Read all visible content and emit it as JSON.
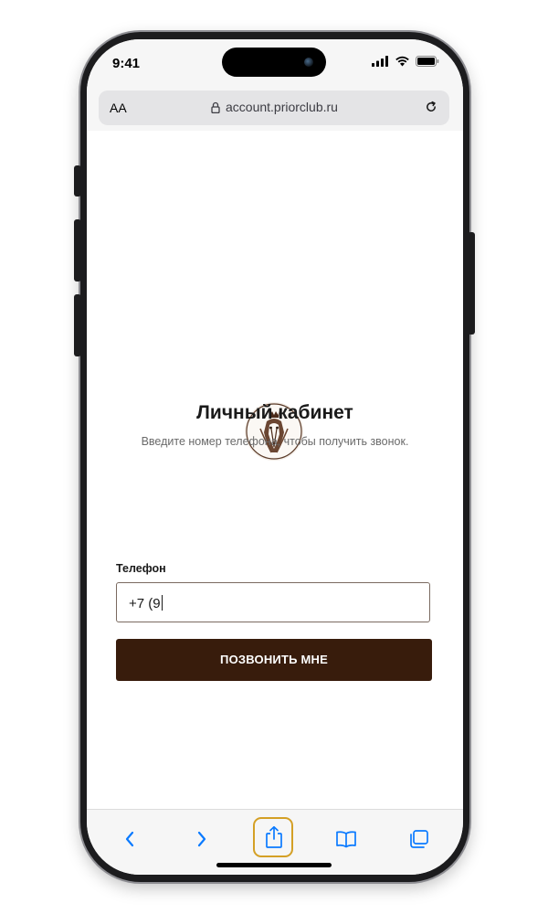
{
  "status_bar": {
    "time": "9:41"
  },
  "browser": {
    "text_size_label": "AA",
    "url": "account.priorclub.ru"
  },
  "page": {
    "title": "Личный кабинет",
    "subtitle": "Введите номер телефона, чтобы получить звонок.",
    "phone_label": "Телефон",
    "phone_value": "+7 (9",
    "call_button_label": "ПОЗВОНИТЬ МНЕ"
  },
  "toolbar": {
    "icons": [
      "back-icon",
      "forward-icon",
      "share-icon",
      "bookmarks-icon",
      "tabs-icon"
    ],
    "highlight_color": "#d4a026"
  },
  "colors": {
    "accent_button": "#381c0c",
    "link_blue": "#0a7aff"
  }
}
